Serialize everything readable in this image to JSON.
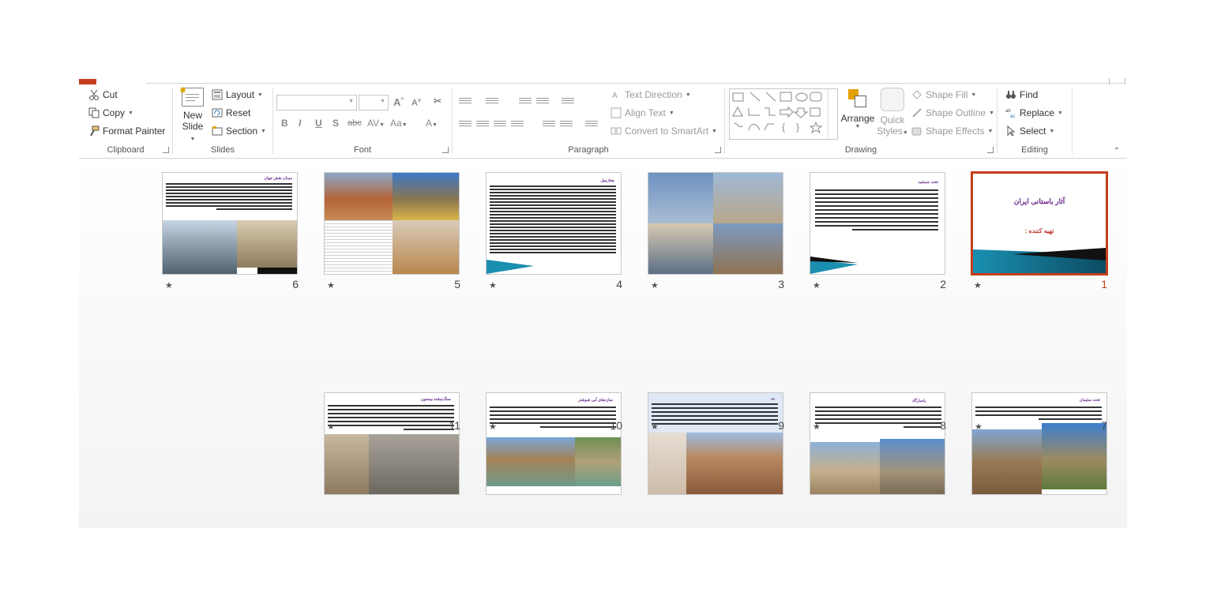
{
  "ribbon": {
    "clipboard": {
      "label": "Clipboard",
      "cut": "Cut",
      "copy": "Copy",
      "format_painter": "Format Painter"
    },
    "slides": {
      "label": "Slides",
      "new_slide_line1": "New",
      "new_slide_line2": "Slide",
      "layout": "Layout",
      "reset": "Reset",
      "section": "Section"
    },
    "font": {
      "label": "Font",
      "bold": "B",
      "italic": "I",
      "underline": "U",
      "shadow": "S",
      "strike": "abc",
      "aa": "Aa",
      "size_up": "A",
      "size_down": "A",
      "color": "A"
    },
    "paragraph": {
      "label": "Paragraph",
      "text_direction": "Text Direction",
      "align_text": "Align Text",
      "convert_smartart": "Convert to SmartArt"
    },
    "drawing": {
      "label": "Drawing",
      "arrange": "Arrange",
      "quick_line1": "Quick",
      "quick_line2": "Styles",
      "shape_fill": "Shape Fill",
      "shape_outline": "Shape Outline",
      "shape_effects": "Shape Effects"
    },
    "editing": {
      "label": "Editing",
      "find": "Find",
      "replace": "Replace",
      "select": "Select"
    }
  },
  "slides": [
    {
      "number": "1",
      "title": "آثار باستانی ایران",
      "subtitle": "تهیه کننده :",
      "selected": true
    },
    {
      "number": "2",
      "title": "تخت جمشید"
    },
    {
      "number": "3"
    },
    {
      "number": "4",
      "title": "چغازنبیل"
    },
    {
      "number": "5"
    },
    {
      "number": "6",
      "title": "میدان نقش جهان"
    },
    {
      "number": "7",
      "title": "تخت سلیمان"
    },
    {
      "number": "8",
      "title": "پاسارگاد"
    },
    {
      "number": "9",
      "title": "بم"
    },
    {
      "number": "10",
      "title": "سازه‌های آبی شوشتر"
    },
    {
      "number": "11",
      "title": "سنگ‌نبشته بیستون"
    }
  ],
  "star_glyph": "★",
  "colors": {
    "accent": "#c43e1c",
    "title_purple": "#6a2a8c",
    "subtitle_red": "#c0392b"
  }
}
